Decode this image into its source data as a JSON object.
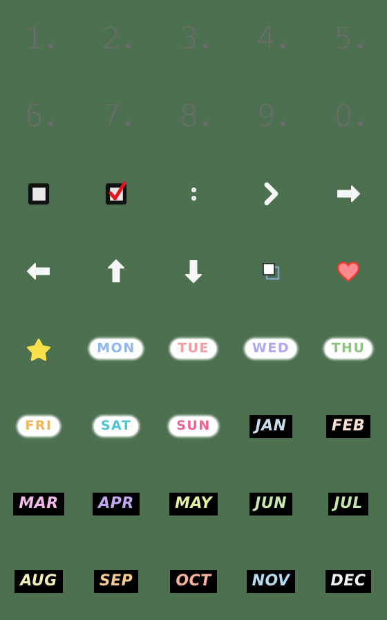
{
  "canvas": {
    "background_color": "#4d7050",
    "columns": 5,
    "rows": 8
  },
  "palette": {
    "numeral_gray": "#6d6d6d",
    "sticker_white": "#ffffff",
    "block_black": "#000000",
    "check_red": "#e8161c",
    "heart_fill": "#f98a92",
    "heart_outline": "#ef3b2c",
    "star_yellow": "#f7e04a",
    "arrow_white": "#f4f6f8",
    "copy_blue": "#7aa3c4"
  },
  "stickers": [
    {
      "row": 1,
      "col": 1,
      "kind": "numeral",
      "label": "1.",
      "digit": "1",
      "color": "#6d6d6d"
    },
    {
      "row": 1,
      "col": 2,
      "kind": "numeral",
      "label": "2.",
      "digit": "2",
      "color": "#6d6d6d"
    },
    {
      "row": 1,
      "col": 3,
      "kind": "numeral",
      "label": "3.",
      "digit": "3",
      "color": "#6d6d6d"
    },
    {
      "row": 1,
      "col": 4,
      "kind": "numeral",
      "label": "4.",
      "digit": "4",
      "color": "#6d6d6d"
    },
    {
      "row": 1,
      "col": 5,
      "kind": "numeral",
      "label": "5.",
      "digit": "5",
      "color": "#6d6d6d"
    },
    {
      "row": 2,
      "col": 1,
      "kind": "numeral",
      "label": "6.",
      "digit": "6",
      "color": "#6d6d6d"
    },
    {
      "row": 2,
      "col": 2,
      "kind": "numeral",
      "label": "7.",
      "digit": "7",
      "color": "#6d6d6d"
    },
    {
      "row": 2,
      "col": 3,
      "kind": "numeral",
      "label": "8.",
      "digit": "8",
      "color": "#6d6d6d"
    },
    {
      "row": 2,
      "col": 4,
      "kind": "numeral",
      "label": "9.",
      "digit": "9",
      "color": "#6d6d6d"
    },
    {
      "row": 2,
      "col": 5,
      "kind": "numeral",
      "label": "0.",
      "digit": "0",
      "color": "#6d6d6d"
    },
    {
      "row": 3,
      "col": 1,
      "kind": "icon",
      "icon": "ballot-box-empty-icon",
      "label": "Empty ballot box"
    },
    {
      "row": 3,
      "col": 2,
      "kind": "icon",
      "icon": "ballot-box-with-check-icon",
      "label": "Ballot box with red check"
    },
    {
      "row": 3,
      "col": 3,
      "kind": "icon",
      "icon": "two-dots-icon",
      "label": "Two dots"
    },
    {
      "row": 3,
      "col": 4,
      "kind": "icon",
      "icon": "chevron-right-icon",
      "label": "Chevron right"
    },
    {
      "row": 3,
      "col": 5,
      "kind": "icon",
      "icon": "arrow-right-icon",
      "label": "Arrow right"
    },
    {
      "row": 4,
      "col": 1,
      "kind": "icon",
      "icon": "arrow-left-icon",
      "label": "Arrow left"
    },
    {
      "row": 4,
      "col": 2,
      "kind": "icon",
      "icon": "arrow-up-icon",
      "label": "Arrow up"
    },
    {
      "row": 4,
      "col": 3,
      "kind": "icon",
      "icon": "arrow-down-icon",
      "label": "Arrow down"
    },
    {
      "row": 4,
      "col": 4,
      "kind": "icon",
      "icon": "copy-icon",
      "label": "Copy / duplicate"
    },
    {
      "row": 4,
      "col": 5,
      "kind": "icon",
      "icon": "heart-icon",
      "label": "Pink heart"
    },
    {
      "row": 5,
      "col": 1,
      "kind": "icon",
      "icon": "star-icon",
      "label": "Yellow star"
    },
    {
      "row": 5,
      "col": 2,
      "kind": "pill",
      "label": "MON",
      "color": "#8db7ee"
    },
    {
      "row": 5,
      "col": 3,
      "kind": "pill",
      "label": "TUE",
      "color": "#f79ba0"
    },
    {
      "row": 5,
      "col": 4,
      "kind": "pill",
      "label": "WED",
      "color": "#afa8ec"
    },
    {
      "row": 5,
      "col": 5,
      "kind": "pill",
      "label": "THU",
      "color": "#8bc47f"
    },
    {
      "row": 6,
      "col": 1,
      "kind": "pill",
      "label": "FRI",
      "color": "#f5b451"
    },
    {
      "row": 6,
      "col": 2,
      "kind": "pill",
      "label": "SAT",
      "color": "#4dc4d4"
    },
    {
      "row": 6,
      "col": 3,
      "kind": "pill",
      "label": "SUN",
      "color": "#f2608c"
    },
    {
      "row": 6,
      "col": 4,
      "kind": "block",
      "label": "JAN",
      "color": "#c6dced"
    },
    {
      "row": 6,
      "col": 5,
      "kind": "block",
      "label": "FEB",
      "color": "#fae0cf"
    },
    {
      "row": 7,
      "col": 1,
      "kind": "block",
      "label": "MAR",
      "color": "#f3b9e8"
    },
    {
      "row": 7,
      "col": 2,
      "kind": "block",
      "label": "APR",
      "color": "#c2a6ef"
    },
    {
      "row": 7,
      "col": 3,
      "kind": "block",
      "label": "MAY",
      "color": "#e3f0a2"
    },
    {
      "row": 7,
      "col": 4,
      "kind": "block",
      "label": "JUN",
      "color": "#c6e8ae"
    },
    {
      "row": 7,
      "col": 5,
      "kind": "block",
      "label": "JUL",
      "color": "#c6e8ae"
    },
    {
      "row": 8,
      "col": 1,
      "kind": "block",
      "label": "AUG",
      "color": "#f4efb8"
    },
    {
      "row": 8,
      "col": 2,
      "kind": "block",
      "label": "SEP",
      "color": "#f6cb8e"
    },
    {
      "row": 8,
      "col": 3,
      "kind": "block",
      "label": "OCT",
      "color": "#f6b3a0"
    },
    {
      "row": 8,
      "col": 4,
      "kind": "block",
      "label": "NOV",
      "color": "#b4dcf2"
    },
    {
      "row": 8,
      "col": 5,
      "kind": "block",
      "label": "DEC",
      "color": "#f2f2f2"
    }
  ]
}
